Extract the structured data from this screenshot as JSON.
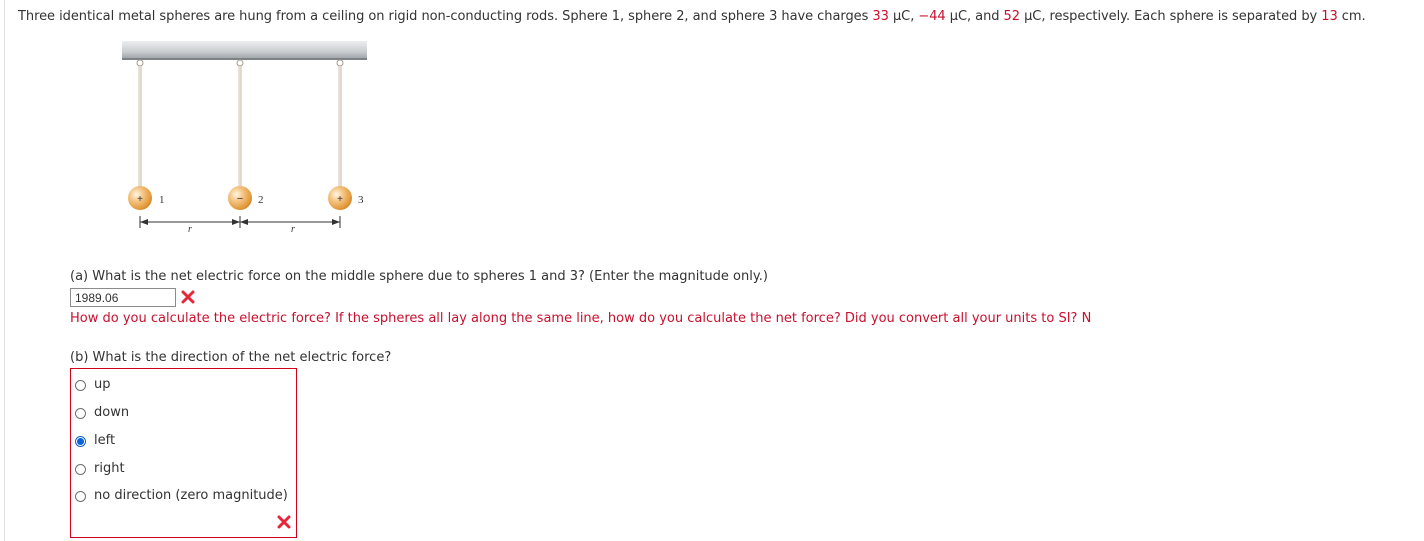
{
  "problem": {
    "intro": "Three identical metal spheres are hung from a ceiling on rigid non-conducting rods. Sphere 1, sphere 2, and sphere 3 have charges ",
    "q1": "33",
    "u1": " µC, ",
    "q2": "−44",
    "u2": " µC, and ",
    "q3": "52",
    "u3": " µC, respectively. Each sphere is separated by ",
    "sep": "13",
    "end": " cm."
  },
  "figure": {
    "sphere_labels": [
      "1",
      "2",
      "3"
    ],
    "sphere_signs": [
      "+",
      "−",
      "+"
    ],
    "separation_label": "r"
  },
  "part_a": {
    "question": "(a) What is the net electric force on the middle sphere due to spheres 1 and 3? (Enter the magnitude only.)",
    "answer_value": "1989.06",
    "hint": "How do you calculate the electric force? If the spheres all lay along the same line, how do you calculate the net force? Did you convert all your units to SI? N"
  },
  "part_b": {
    "question": "(b) What is the direction of the net electric force?",
    "options": [
      {
        "label": "up",
        "checked": false
      },
      {
        "label": "down",
        "checked": false
      },
      {
        "label": "left",
        "checked": true
      },
      {
        "label": "right",
        "checked": false
      },
      {
        "label": "no direction (zero magnitude)",
        "checked": false
      }
    ]
  },
  "colors": {
    "highlight_red": "#c8102e",
    "incorrect_mark": "#e8263a",
    "radio_checked": "#0b62d6"
  }
}
